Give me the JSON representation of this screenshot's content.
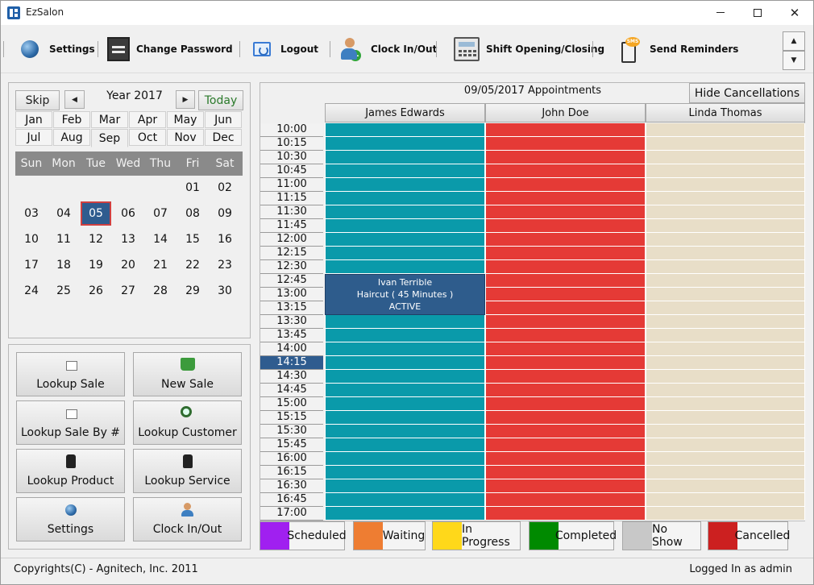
{
  "window": {
    "title": "EzSalon"
  },
  "toolbar": {
    "items": [
      {
        "label": "Settings",
        "icon": "globe-icon"
      },
      {
        "label": "Change Password",
        "icon": "password-icon"
      },
      {
        "label": "Logout",
        "icon": "logout-icon"
      },
      {
        "label": "Clock In/Out",
        "icon": "clock-in-icon"
      },
      {
        "label": "Shift Opening/Closing",
        "icon": "cash-register-icon"
      },
      {
        "label": "Send Reminders",
        "icon": "sms-icon"
      }
    ],
    "scroll_up": "▲",
    "scroll_down": "▼"
  },
  "calendar": {
    "skip_label": "Skip",
    "prev_label": "◀",
    "next_label": "▶",
    "year_label": "Year 2017",
    "today_label": "Today",
    "months": [
      "Jan",
      "Feb",
      "Mar",
      "Apr",
      "May",
      "Jun",
      "Jul",
      "Aug",
      "Sep",
      "Oct",
      "Nov",
      "Dec"
    ],
    "selected_month": "Sep",
    "weekdays": [
      "Sun",
      "Mon",
      "Tue",
      "Wed",
      "Thu",
      "Fri",
      "Sat"
    ],
    "weeks": [
      [
        "",
        "",
        "",
        "",
        "",
        "01",
        "02"
      ],
      [
        "03",
        "04",
        "05",
        "06",
        "07",
        "08",
        "09"
      ],
      [
        "10",
        "11",
        "12",
        "13",
        "14",
        "15",
        "16"
      ],
      [
        "17",
        "18",
        "19",
        "20",
        "21",
        "22",
        "23"
      ],
      [
        "24",
        "25",
        "26",
        "27",
        "28",
        "29",
        "30"
      ]
    ],
    "selected_day": "05"
  },
  "actions": [
    {
      "label": "Lookup Sale",
      "icon": "receipt-icon"
    },
    {
      "label": "New Sale",
      "icon": "basket-icon"
    },
    {
      "label": "Lookup Sale By #",
      "icon": "receipt-icon"
    },
    {
      "label": "Lookup Customer",
      "icon": "magnifier-icon"
    },
    {
      "label": "Lookup Product",
      "icon": "tag-icon"
    },
    {
      "label": "Lookup Service",
      "icon": "tag-icon"
    },
    {
      "label": "Settings",
      "icon": "globe-icon"
    },
    {
      "label": "Clock In/Out",
      "icon": "clock-in-icon"
    }
  ],
  "schedule": {
    "title": "09/05/2017 Appointments",
    "hide_cancellations_label": "Hide Cancellations",
    "staff": [
      {
        "name": "James Edwards",
        "color": "#0a9aaa"
      },
      {
        "name": "John Doe",
        "color": "#e53a36"
      },
      {
        "name": "Linda Thomas",
        "color": "#e8dec8"
      }
    ],
    "times": [
      "10:00",
      "10:15",
      "10:30",
      "10:45",
      "11:00",
      "11:15",
      "11:30",
      "11:45",
      "12:00",
      "12:15",
      "12:30",
      "12:45",
      "13:00",
      "13:15",
      "13:30",
      "13:45",
      "14:00",
      "14:15",
      "14:30",
      "14:45",
      "15:00",
      "15:15",
      "15:30",
      "15:45",
      "16:00",
      "16:15",
      "16:30",
      "16:45",
      "17:00"
    ],
    "selected_time": "14:15",
    "appointments": [
      {
        "staff": "James Edwards",
        "start": "12:45",
        "slots": 3,
        "customer": "Ivan Terrible",
        "service": "Haircut ( 45 Minutes )",
        "status": "ACTIVE"
      }
    ]
  },
  "legend": [
    {
      "label": "Scheduled",
      "color": "#a020f0"
    },
    {
      "label": "Waiting",
      "color": "#ee7d32"
    },
    {
      "label": "In Progress",
      "color": "#ffd81a"
    },
    {
      "label": "Completed",
      "color": "#008a00"
    },
    {
      "label": "No Show",
      "color": "#c8c8c8"
    },
    {
      "label": "Cancelled",
      "color": "#cc2020"
    }
  ],
  "status": {
    "copyright": "Copyrights(C) - Agnitech, Inc. 2011",
    "logged_in": "Logged In as admin"
  }
}
